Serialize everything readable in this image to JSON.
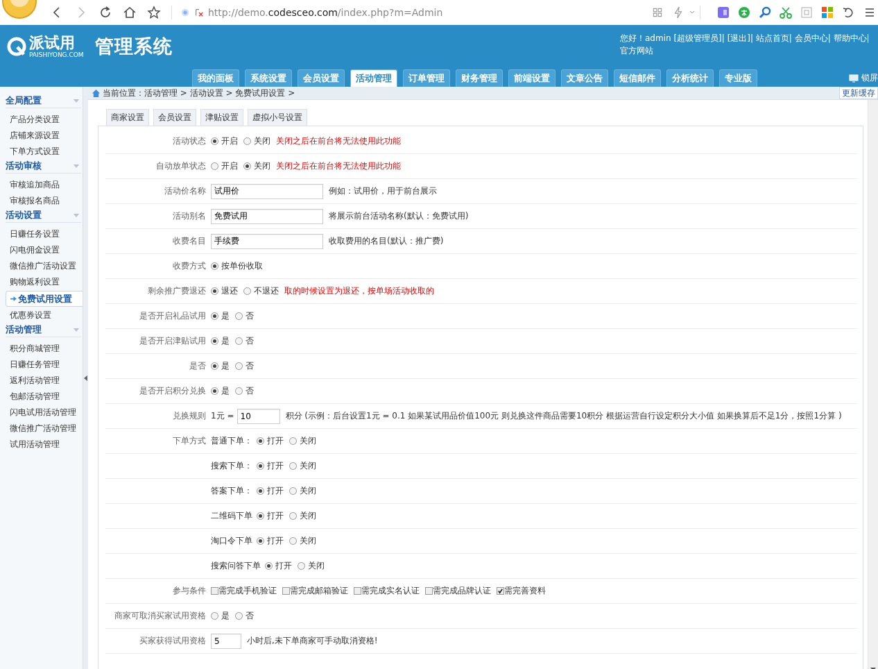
{
  "browser": {
    "url": [
      {
        "text": "http://demo.",
        "kind": "dim"
      },
      {
        "text": "codesceo.com",
        "kind": "main"
      },
      {
        "text": "/index.php?m=Admin",
        "kind": "dim"
      }
    ]
  },
  "header": {
    "logo": "派试用",
    "logo_sub": "PAISHIYONG.COM",
    "title": "管理系统",
    "user_links": "您好！admin [超级管理员]| [退出]| 站点首页| 会员中心| 帮助中心| 官方网站"
  },
  "nav": [
    {
      "label": "我的面板",
      "selected": false
    },
    {
      "label": "系统设置",
      "selected": false
    },
    {
      "label": "会员设置",
      "selected": false
    },
    {
      "label": "活动管理",
      "selected": true
    },
    {
      "label": "订单管理",
      "selected": false
    },
    {
      "label": "财务管理",
      "selected": false
    },
    {
      "label": "前端设置",
      "selected": false
    },
    {
      "label": "文章公告",
      "selected": false
    },
    {
      "label": "短信邮件",
      "selected": false
    },
    {
      "label": "分析统计",
      "selected": false
    },
    {
      "label": "专业版",
      "selected": false
    }
  ],
  "lock": "锁屏",
  "breadcrumb": "当前位置：活动管理 > 活动设置 > 免费试用设置 >",
  "cache_button": "更新缓存",
  "sidebar": [
    {
      "title": "全局配置",
      "items": [
        {
          "label": "产品分类设置",
          "selected": false
        },
        {
          "label": "店铺来源设置",
          "selected": false
        },
        {
          "label": "下单方式设置",
          "selected": false
        }
      ]
    },
    {
      "title": "活动审核",
      "items": [
        {
          "label": "审核追加商品",
          "selected": false
        },
        {
          "label": "审核报名商品",
          "selected": false
        }
      ]
    },
    {
      "title": "活动设置",
      "items": [
        {
          "label": "日赚任务设置",
          "selected": false
        },
        {
          "label": "闪电佣金设置",
          "selected": false
        },
        {
          "label": "微信推广活动设置",
          "selected": false
        },
        {
          "label": "购物返利设置",
          "selected": false
        },
        {
          "label": "免费试用设置",
          "selected": true
        },
        {
          "label": "优惠券设置",
          "selected": false
        }
      ]
    },
    {
      "title": "活动管理",
      "items": [
        {
          "label": "积分商城管理",
          "selected": false
        },
        {
          "label": "日赚任务管理",
          "selected": false
        },
        {
          "label": "返利活动管理",
          "selected": false
        },
        {
          "label": "包邮活动管理",
          "selected": false
        },
        {
          "label": "闪电试用活动管理",
          "selected": false
        },
        {
          "label": "微信推广活动管理",
          "selected": false
        },
        {
          "label": "试用活动管理",
          "selected": false
        }
      ]
    }
  ],
  "tabs": [
    {
      "label": "商家设置",
      "selected": false
    },
    {
      "label": "会员设置",
      "selected": false
    },
    {
      "label": "津贴设置",
      "selected": false
    },
    {
      "label": "虚拟小号设置",
      "selected": false
    }
  ],
  "form": [
    {
      "kind": "radio",
      "label": "活动状态",
      "options": [
        {
          "label": "开启",
          "selected": true
        },
        {
          "label": "关闭",
          "selected": false
        }
      ],
      "hint": {
        "text": "关闭之后在前台将无法使用此功能",
        "warning": true
      }
    },
    {
      "kind": "radio",
      "label": "自动放单状态",
      "options": [
        {
          "label": "开启",
          "selected": false
        },
        {
          "label": "关闭",
          "selected": true
        }
      ],
      "hint": {
        "text": "关闭之后在前台将无法使用此功能",
        "warning": true
      }
    },
    {
      "kind": "text",
      "label": "活动价名称",
      "value": "试用价",
      "hint": {
        "text": "例如：试用价，用于前台展示",
        "warning": false
      }
    },
    {
      "kind": "text",
      "label": "活动别名",
      "value": "免费试用",
      "hint": {
        "text": "将展示前台活动名称(默认：免费试用)",
        "warning": false
      }
    },
    {
      "kind": "text",
      "label": "收费名目",
      "value": "手续费",
      "hint": {
        "text": "收取费用的名目(默认：推广费)",
        "warning": false
      }
    },
    {
      "kind": "radio",
      "label": "收费方式",
      "options": [
        {
          "label": "按单份收取",
          "selected": true
        }
      ]
    },
    {
      "kind": "radio",
      "label": "剩余推广费退还",
      "options": [
        {
          "label": "退还",
          "selected": true
        },
        {
          "label": "不退还",
          "selected": false
        }
      ],
      "hint": {
        "text": "取的时候设置为退还，按单场活动收取的",
        "warning": true
      }
    },
    {
      "kind": "radio",
      "label": "是否开启礼品试用",
      "options": [
        {
          "label": "是",
          "selected": true
        },
        {
          "label": "否",
          "selected": false
        }
      ]
    },
    {
      "kind": "radio",
      "label": "是否开启津贴试用",
      "options": [
        {
          "label": "是",
          "selected": true
        },
        {
          "label": "否",
          "selected": false
        }
      ]
    },
    {
      "kind": "radio",
      "label": "是否",
      "options": [
        {
          "label": "是",
          "selected": true
        },
        {
          "label": "否",
          "selected": false
        }
      ]
    },
    {
      "kind": "radio",
      "label": "是否开启积分兑换",
      "options": [
        {
          "label": "是",
          "selected": true
        },
        {
          "label": "否",
          "selected": false
        }
      ]
    },
    {
      "kind": "rule",
      "label": "兑换规则",
      "prefix": "1元 =",
      "value": "10",
      "hint": {
        "text": "积分 (示例：后台设置1元 = 0.1 如果某试用品价值100元 则兑换这件商品需要10积分 根据运营自行设定积分大小值 如果换算后不足1分，按照1分算 )",
        "warning": false
      }
    },
    {
      "kind": "suboption",
      "label": "下单方式",
      "sublabel": "普通下单：",
      "options": [
        {
          "label": "打开",
          "selected": true
        },
        {
          "label": "关闭",
          "selected": false
        }
      ]
    },
    {
      "kind": "suboption",
      "sublabel": "搜索下单：",
      "options": [
        {
          "label": "打开",
          "selected": true
        },
        {
          "label": "关闭",
          "selected": false
        }
      ]
    },
    {
      "kind": "suboption",
      "sublabel": "答案下单：",
      "options": [
        {
          "label": "打开",
          "selected": true
        },
        {
          "label": "关闭",
          "selected": false
        }
      ]
    },
    {
      "kind": "suboption",
      "sublabel": "二维码下单",
      "options": [
        {
          "label": "打开",
          "selected": true
        },
        {
          "label": "关闭",
          "selected": false
        }
      ]
    },
    {
      "kind": "suboption",
      "sublabel": "淘口令下单",
      "options": [
        {
          "label": "打开",
          "selected": true
        },
        {
          "label": "关闭",
          "selected": false
        }
      ]
    },
    {
      "kind": "suboption",
      "sublabel": "搜索问答下单",
      "options": [
        {
          "label": "打开",
          "selected": true
        },
        {
          "label": "关闭",
          "selected": false
        }
      ]
    },
    {
      "kind": "checks",
      "label": "参与条件",
      "options": [
        {
          "label": "需完成手机验证",
          "checked": false
        },
        {
          "label": "需完成邮箱验证",
          "checked": false
        },
        {
          "label": "需完成实名认证",
          "checked": false
        },
        {
          "label": "需完成品牌认证",
          "checked": false
        },
        {
          "label": "需完善资料",
          "checked": true
        }
      ]
    },
    {
      "kind": "radio",
      "label": "商家可取消买家试用资格",
      "options": [
        {
          "label": "是",
          "selected": false
        },
        {
          "label": "否",
          "selected": false
        }
      ]
    },
    {
      "kind": "short_text",
      "label": "买家获得试用资格",
      "value": "5",
      "hint": {
        "text": "小时后,未下单商家可手动取消资格!",
        "warning": false
      }
    }
  ]
}
